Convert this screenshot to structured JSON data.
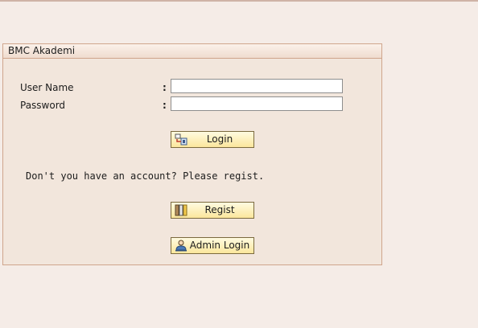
{
  "panel": {
    "title": "BMC Akademi"
  },
  "form": {
    "username_label": "User Name",
    "password_label": "Password",
    "separator": ":",
    "username_value": "",
    "password_value": ""
  },
  "buttons": {
    "login_label": "Login",
    "regist_label": "Regist",
    "admin_login_label": "Admin Login"
  },
  "register_message": "Don't you have an account? Please regist.",
  "icons": {
    "login": "login-icon",
    "regist": "regist-icon",
    "admin_login": "admin-user-icon"
  },
  "colors": {
    "page_background": "#f5ece7",
    "panel_background": "#f2e6dc",
    "panel_border": "#cfa58c",
    "button_fill": "#fbe69c"
  }
}
